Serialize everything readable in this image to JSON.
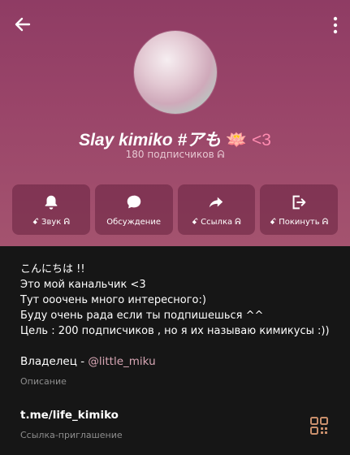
{
  "channel": {
    "name": "Slay kimiko #アも",
    "name_emoji": "🪷",
    "name_suffix": "<3",
    "subscribers": "180 подписчиков ᕱ"
  },
  "actions": [
    {
      "label": "ꗃ Звук ᕱ",
      "icon": "bell-icon"
    },
    {
      "label": "Обсуждение",
      "icon": "chat-bubble-icon"
    },
    {
      "label": "ꗃ Ссылка ᕱ",
      "icon": "share-arrow-icon"
    },
    {
      "label": "ꗃ Покинуть ᕱ",
      "icon": "leave-icon"
    }
  ],
  "description": "こんにちは !!\nЭто мой канальчик <3\nТут ооочень много интересного:)\nБуду очень рада если ты подпишешься ^^\nЦель : 200 подписчиков , но я их называю кимикусы :))",
  "owner": {
    "prefix": "Владелец - ",
    "handle": "@little_miku"
  },
  "description_label": "Описание",
  "invite": {
    "link": "t.me/life_kimiko",
    "label": "Ссылка-приглашение"
  },
  "colors": {
    "header_top": "#8f3c64",
    "header_bottom": "#a4536f",
    "background": "#161616",
    "accent": "#ff8bb0"
  }
}
